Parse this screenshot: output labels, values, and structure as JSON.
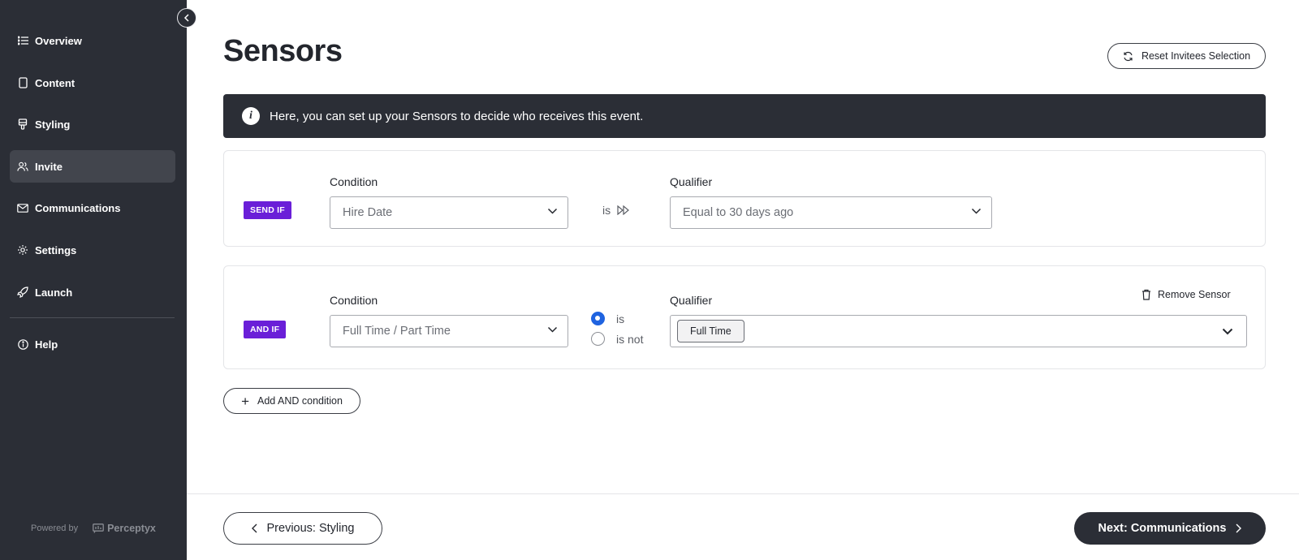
{
  "sidebar": {
    "items": [
      {
        "label": "Overview",
        "icon": "list-icon",
        "active": false
      },
      {
        "label": "Content",
        "icon": "document-icon",
        "active": false
      },
      {
        "label": "Styling",
        "icon": "brush-icon",
        "active": false
      },
      {
        "label": "Invite",
        "icon": "users-icon",
        "active": true
      },
      {
        "label": "Communications",
        "icon": "mail-icon",
        "active": false
      },
      {
        "label": "Settings",
        "icon": "gear-icon",
        "active": false
      },
      {
        "label": "Launch",
        "icon": "rocket-icon",
        "active": false
      }
    ],
    "help_label": "Help",
    "powered_by": "Powered by",
    "brand": "Perceptyx"
  },
  "page": {
    "title": "Sensors",
    "reset_label": "Reset Invitees Selection",
    "banner_text": "Here, you can set up your Sensors to decide who receives this event."
  },
  "sensors": [
    {
      "badge": "SEND IF",
      "condition_label": "Condition",
      "condition_value": "Hire Date",
      "operator": "is",
      "qualifier_label": "Qualifier",
      "qualifier_value": "Equal to 30 days ago"
    },
    {
      "badge": "AND IF",
      "condition_label": "Condition",
      "condition_value": "Full Time / Part Time",
      "radio_options": [
        "is",
        "is not"
      ],
      "radio_selected": "is",
      "qualifier_label": "Qualifier",
      "qualifier_chip": "Full Time",
      "remove_label": "Remove Sensor"
    }
  ],
  "add_condition_label": "Add AND condition",
  "footer": {
    "prev_label": "Previous: Styling",
    "next_label": "Next: Communications"
  },
  "colors": {
    "sidebar_bg": "#2b2e36",
    "badge_purple": "#6a1fd8",
    "radio_blue": "#1f63e0"
  }
}
